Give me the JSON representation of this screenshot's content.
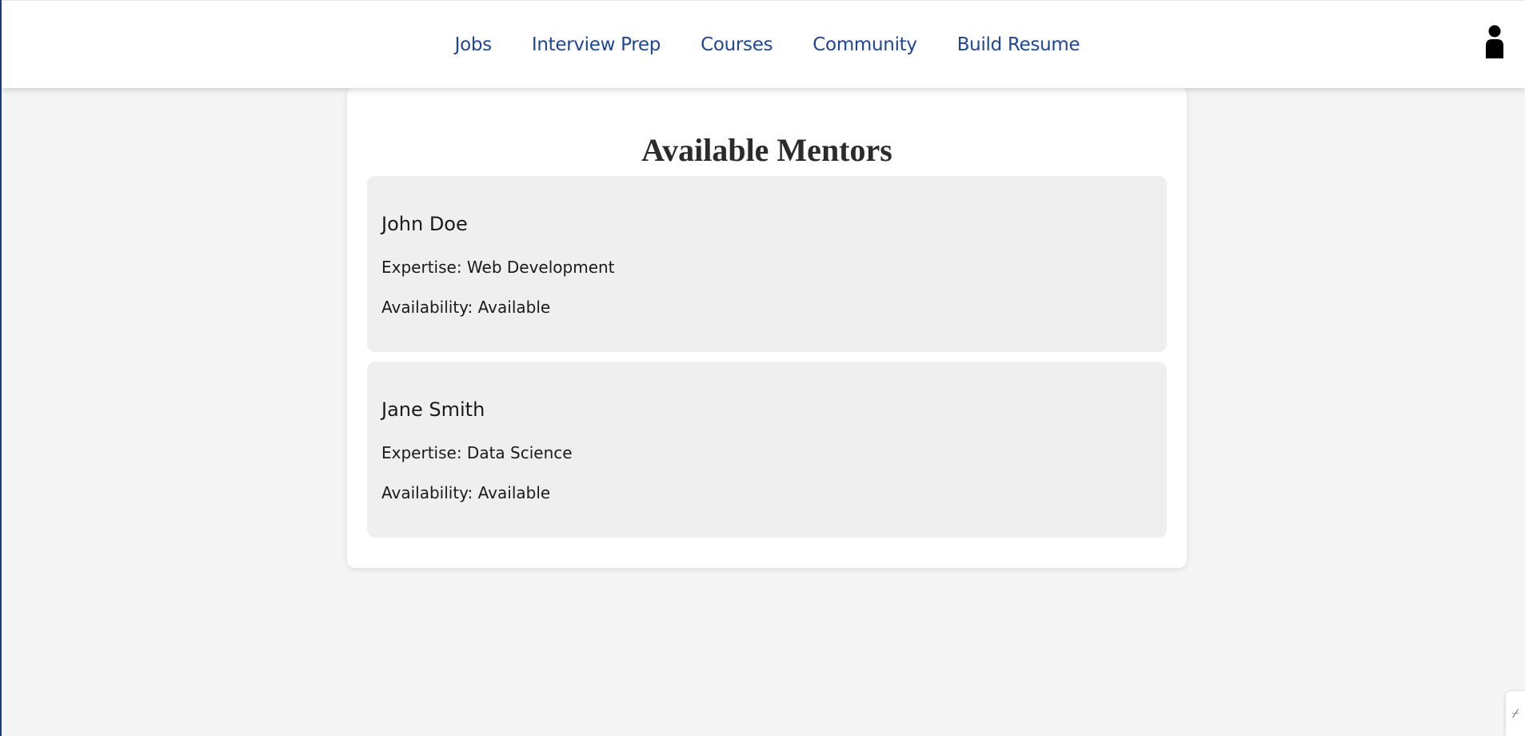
{
  "nav": {
    "items": [
      {
        "label": "Jobs"
      },
      {
        "label": "Interview Prep"
      },
      {
        "label": "Courses"
      },
      {
        "label": "Community"
      },
      {
        "label": "Build Resume"
      }
    ]
  },
  "header": {
    "user_icon": "user-icon"
  },
  "main": {
    "title": "Available Mentors",
    "mentors": [
      {
        "name": "John Doe",
        "expertise": "Expertise: Web Development",
        "availability": "Availability: Available"
      },
      {
        "name": "Jane Smith",
        "expertise": "Expertise: Data Science",
        "availability": "Availability: Available"
      }
    ]
  },
  "colors": {
    "nav_link": "#1f4596",
    "page_background": "#f5f5f5",
    "card_background": "#efefef"
  }
}
